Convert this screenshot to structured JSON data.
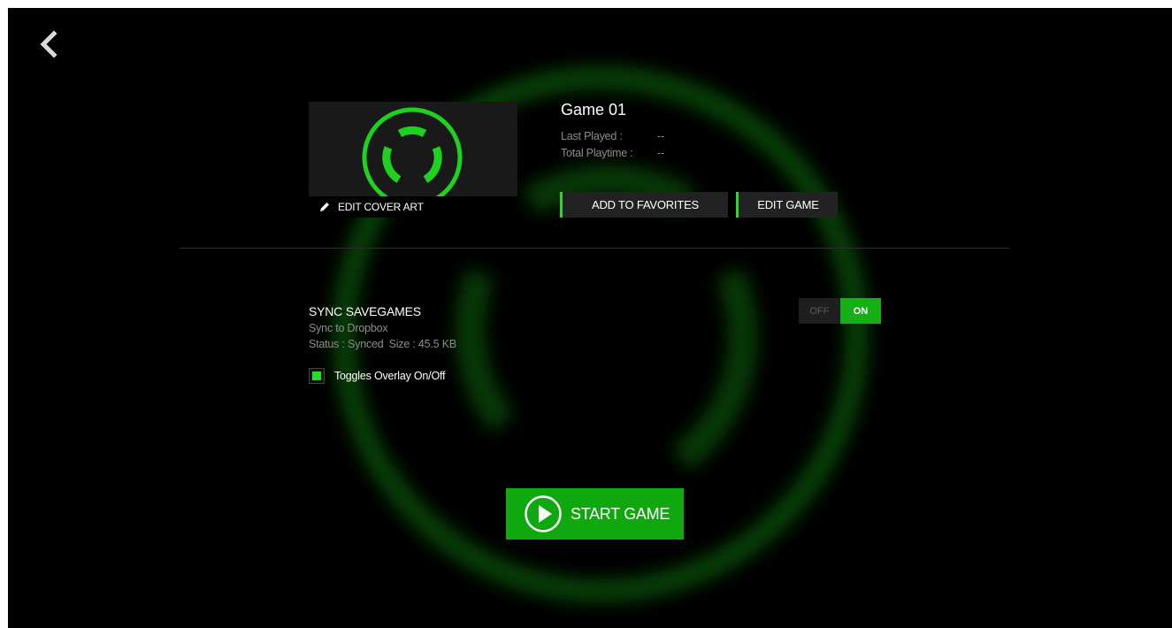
{
  "nav": {
    "back_icon": "chevron-left-icon"
  },
  "game": {
    "title": "Game 01",
    "cover_action": "EDIT COVER ART",
    "last_played_label": "Last Played :",
    "last_played_value": "--",
    "total_playtime_label": "Total Playtime :",
    "total_playtime_value": "--"
  },
  "actions": {
    "add_to_favorites": "ADD TO FAVORITES",
    "edit_game": "EDIT GAME"
  },
  "sync": {
    "title": "SYNC SAVEGAMES",
    "subtitle": "Sync to Dropbox",
    "status": "Status : Synced",
    "size": "Size : 45.5 KB",
    "toggle_off": "OFF",
    "toggle_on": "ON",
    "toggle_state": "ON"
  },
  "overlay": {
    "label": "Toggles Overlay On/Off",
    "checked": true
  },
  "start": {
    "label": "START GAME"
  },
  "colors": {
    "accent": "#16b016",
    "accent_bright": "#22e022",
    "background": "#000000",
    "button_bg": "#222222"
  }
}
